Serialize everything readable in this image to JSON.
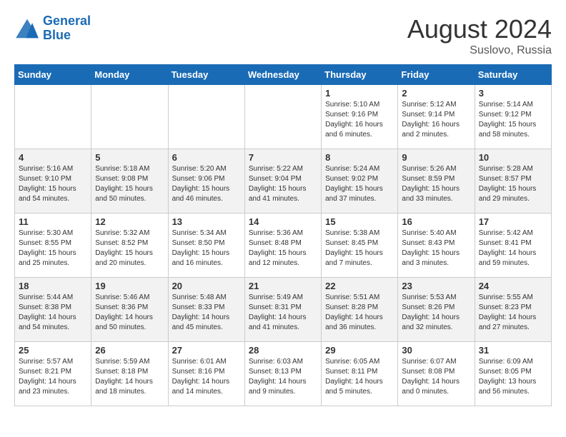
{
  "logo": {
    "line1": "General",
    "line2": "Blue"
  },
  "title": {
    "month_year": "August 2024",
    "location": "Suslovo, Russia"
  },
  "headers": [
    "Sunday",
    "Monday",
    "Tuesday",
    "Wednesday",
    "Thursday",
    "Friday",
    "Saturday"
  ],
  "weeks": [
    [
      {
        "day": "",
        "content": ""
      },
      {
        "day": "",
        "content": ""
      },
      {
        "day": "",
        "content": ""
      },
      {
        "day": "",
        "content": ""
      },
      {
        "day": "1",
        "content": "Sunrise: 5:10 AM\nSunset: 9:16 PM\nDaylight: 16 hours\nand 6 minutes."
      },
      {
        "day": "2",
        "content": "Sunrise: 5:12 AM\nSunset: 9:14 PM\nDaylight: 16 hours\nand 2 minutes."
      },
      {
        "day": "3",
        "content": "Sunrise: 5:14 AM\nSunset: 9:12 PM\nDaylight: 15 hours\nand 58 minutes."
      }
    ],
    [
      {
        "day": "4",
        "content": "Sunrise: 5:16 AM\nSunset: 9:10 PM\nDaylight: 15 hours\nand 54 minutes."
      },
      {
        "day": "5",
        "content": "Sunrise: 5:18 AM\nSunset: 9:08 PM\nDaylight: 15 hours\nand 50 minutes."
      },
      {
        "day": "6",
        "content": "Sunrise: 5:20 AM\nSunset: 9:06 PM\nDaylight: 15 hours\nand 46 minutes."
      },
      {
        "day": "7",
        "content": "Sunrise: 5:22 AM\nSunset: 9:04 PM\nDaylight: 15 hours\nand 41 minutes."
      },
      {
        "day": "8",
        "content": "Sunrise: 5:24 AM\nSunset: 9:02 PM\nDaylight: 15 hours\nand 37 minutes."
      },
      {
        "day": "9",
        "content": "Sunrise: 5:26 AM\nSunset: 8:59 PM\nDaylight: 15 hours\nand 33 minutes."
      },
      {
        "day": "10",
        "content": "Sunrise: 5:28 AM\nSunset: 8:57 PM\nDaylight: 15 hours\nand 29 minutes."
      }
    ],
    [
      {
        "day": "11",
        "content": "Sunrise: 5:30 AM\nSunset: 8:55 PM\nDaylight: 15 hours\nand 25 minutes."
      },
      {
        "day": "12",
        "content": "Sunrise: 5:32 AM\nSunset: 8:52 PM\nDaylight: 15 hours\nand 20 minutes."
      },
      {
        "day": "13",
        "content": "Sunrise: 5:34 AM\nSunset: 8:50 PM\nDaylight: 15 hours\nand 16 minutes."
      },
      {
        "day": "14",
        "content": "Sunrise: 5:36 AM\nSunset: 8:48 PM\nDaylight: 15 hours\nand 12 minutes."
      },
      {
        "day": "15",
        "content": "Sunrise: 5:38 AM\nSunset: 8:45 PM\nDaylight: 15 hours\nand 7 minutes."
      },
      {
        "day": "16",
        "content": "Sunrise: 5:40 AM\nSunset: 8:43 PM\nDaylight: 15 hours\nand 3 minutes."
      },
      {
        "day": "17",
        "content": "Sunrise: 5:42 AM\nSunset: 8:41 PM\nDaylight: 14 hours\nand 59 minutes."
      }
    ],
    [
      {
        "day": "18",
        "content": "Sunrise: 5:44 AM\nSunset: 8:38 PM\nDaylight: 14 hours\nand 54 minutes."
      },
      {
        "day": "19",
        "content": "Sunrise: 5:46 AM\nSunset: 8:36 PM\nDaylight: 14 hours\nand 50 minutes."
      },
      {
        "day": "20",
        "content": "Sunrise: 5:48 AM\nSunset: 8:33 PM\nDaylight: 14 hours\nand 45 minutes."
      },
      {
        "day": "21",
        "content": "Sunrise: 5:49 AM\nSunset: 8:31 PM\nDaylight: 14 hours\nand 41 minutes."
      },
      {
        "day": "22",
        "content": "Sunrise: 5:51 AM\nSunset: 8:28 PM\nDaylight: 14 hours\nand 36 minutes."
      },
      {
        "day": "23",
        "content": "Sunrise: 5:53 AM\nSunset: 8:26 PM\nDaylight: 14 hours\nand 32 minutes."
      },
      {
        "day": "24",
        "content": "Sunrise: 5:55 AM\nSunset: 8:23 PM\nDaylight: 14 hours\nand 27 minutes."
      }
    ],
    [
      {
        "day": "25",
        "content": "Sunrise: 5:57 AM\nSunset: 8:21 PM\nDaylight: 14 hours\nand 23 minutes."
      },
      {
        "day": "26",
        "content": "Sunrise: 5:59 AM\nSunset: 8:18 PM\nDaylight: 14 hours\nand 18 minutes."
      },
      {
        "day": "27",
        "content": "Sunrise: 6:01 AM\nSunset: 8:16 PM\nDaylight: 14 hours\nand 14 minutes."
      },
      {
        "day": "28",
        "content": "Sunrise: 6:03 AM\nSunset: 8:13 PM\nDaylight: 14 hours\nand 9 minutes."
      },
      {
        "day": "29",
        "content": "Sunrise: 6:05 AM\nSunset: 8:11 PM\nDaylight: 14 hours\nand 5 minutes."
      },
      {
        "day": "30",
        "content": "Sunrise: 6:07 AM\nSunset: 8:08 PM\nDaylight: 14 hours\nand 0 minutes."
      },
      {
        "day": "31",
        "content": "Sunrise: 6:09 AM\nSunset: 8:05 PM\nDaylight: 13 hours\nand 56 minutes."
      }
    ]
  ]
}
